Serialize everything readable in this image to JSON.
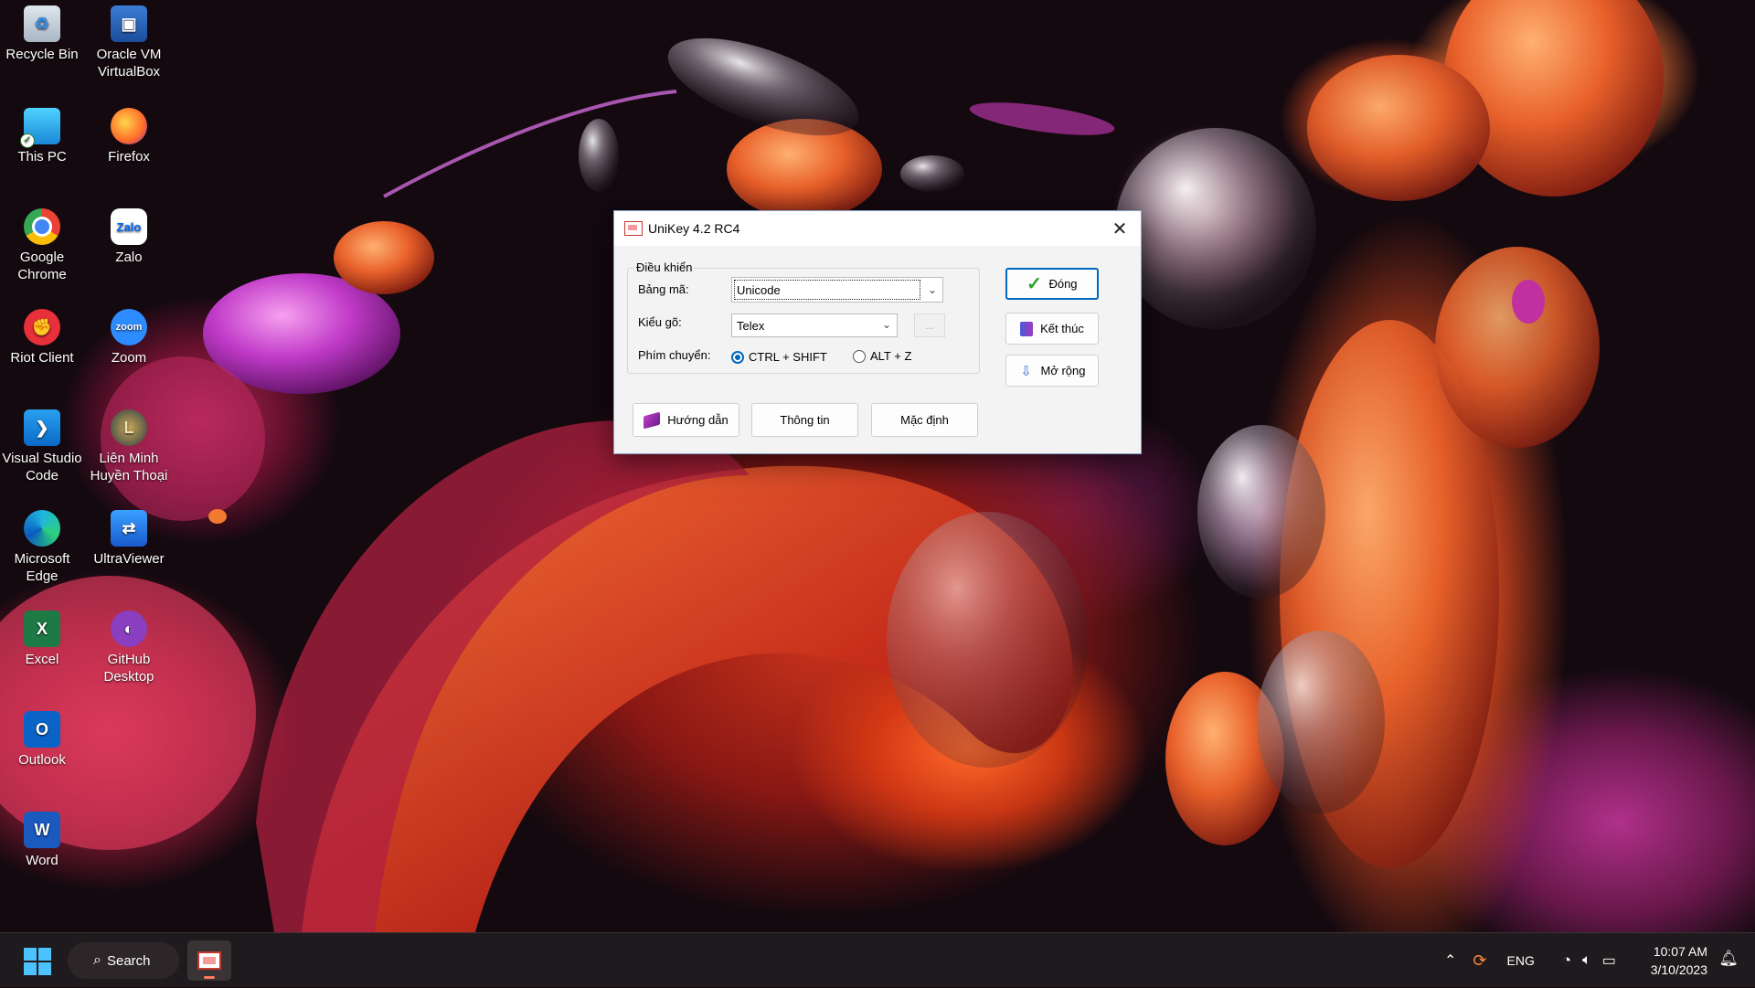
{
  "desktop": {
    "icons": [
      {
        "label_l1": "Recycle Bin",
        "label_l2": "",
        "icon": "recycle-bin-icon"
      },
      {
        "label_l1": "Oracle VM",
        "label_l2": "VirtualBox",
        "icon": "virtualbox-icon"
      },
      {
        "label_l1": "This PC",
        "label_l2": "",
        "icon": "this-pc-icon"
      },
      {
        "label_l1": "Firefox",
        "label_l2": "",
        "icon": "firefox-icon"
      },
      {
        "label_l1": "Google",
        "label_l2": "Chrome",
        "icon": "chrome-icon"
      },
      {
        "label_l1": "Zalo",
        "label_l2": "",
        "icon": "zalo-icon"
      },
      {
        "label_l1": "Riot Client",
        "label_l2": "",
        "icon": "riot-client-icon"
      },
      {
        "label_l1": "Zoom",
        "label_l2": "",
        "icon": "zoom-icon"
      },
      {
        "label_l1": "Visual Studio",
        "label_l2": "Code",
        "icon": "vscode-icon"
      },
      {
        "label_l1": "Liên Minh",
        "label_l2": "Huyền Thoại",
        "icon": "league-icon"
      },
      {
        "label_l1": "Microsoft",
        "label_l2": "Edge",
        "icon": "edge-icon"
      },
      {
        "label_l1": "UltraViewer",
        "label_l2": "",
        "icon": "ultraviewer-icon"
      },
      {
        "label_l1": "Excel",
        "label_l2": "",
        "icon": "excel-icon"
      },
      {
        "label_l1": "GitHub",
        "label_l2": "Desktop",
        "icon": "github-desktop-icon"
      },
      {
        "label_l1": "Outlook",
        "label_l2": "",
        "icon": "outlook-icon"
      },
      {
        "label_l1": "Word",
        "label_l2": "",
        "icon": "word-icon"
      }
    ],
    "icon_texts": {
      "zalo": "Zalo",
      "zoom": "zoom",
      "excel": "X",
      "outlook": "O",
      "word": "W"
    }
  },
  "window": {
    "title": "UniKey 4.2 RC4",
    "close_glyph": "✕",
    "group_label": "Điều khiển",
    "charset_label": "Bảng mã:",
    "charset_value": "Unicode",
    "input_method_label": "Kiểu gõ:",
    "input_method_value": "Telex",
    "ellipsis_label": "...",
    "switch_key_label": "Phím chuyển:",
    "switch_options": [
      {
        "label": "CTRL + SHIFT",
        "selected": true
      },
      {
        "label": "ALT + Z",
        "selected": false
      }
    ],
    "buttons": {
      "close": "Đóng",
      "exit": "Kết thúc",
      "expand": "Mở rộng",
      "guide": "Hướng dẫn",
      "info": "Thông tin",
      "default": "Mặc định"
    },
    "colors": {
      "accent": "#0067c0"
    }
  },
  "taskbar": {
    "search_label": "Search",
    "language": "ENG",
    "time": "10:07 AM",
    "date": "3/10/2023"
  }
}
